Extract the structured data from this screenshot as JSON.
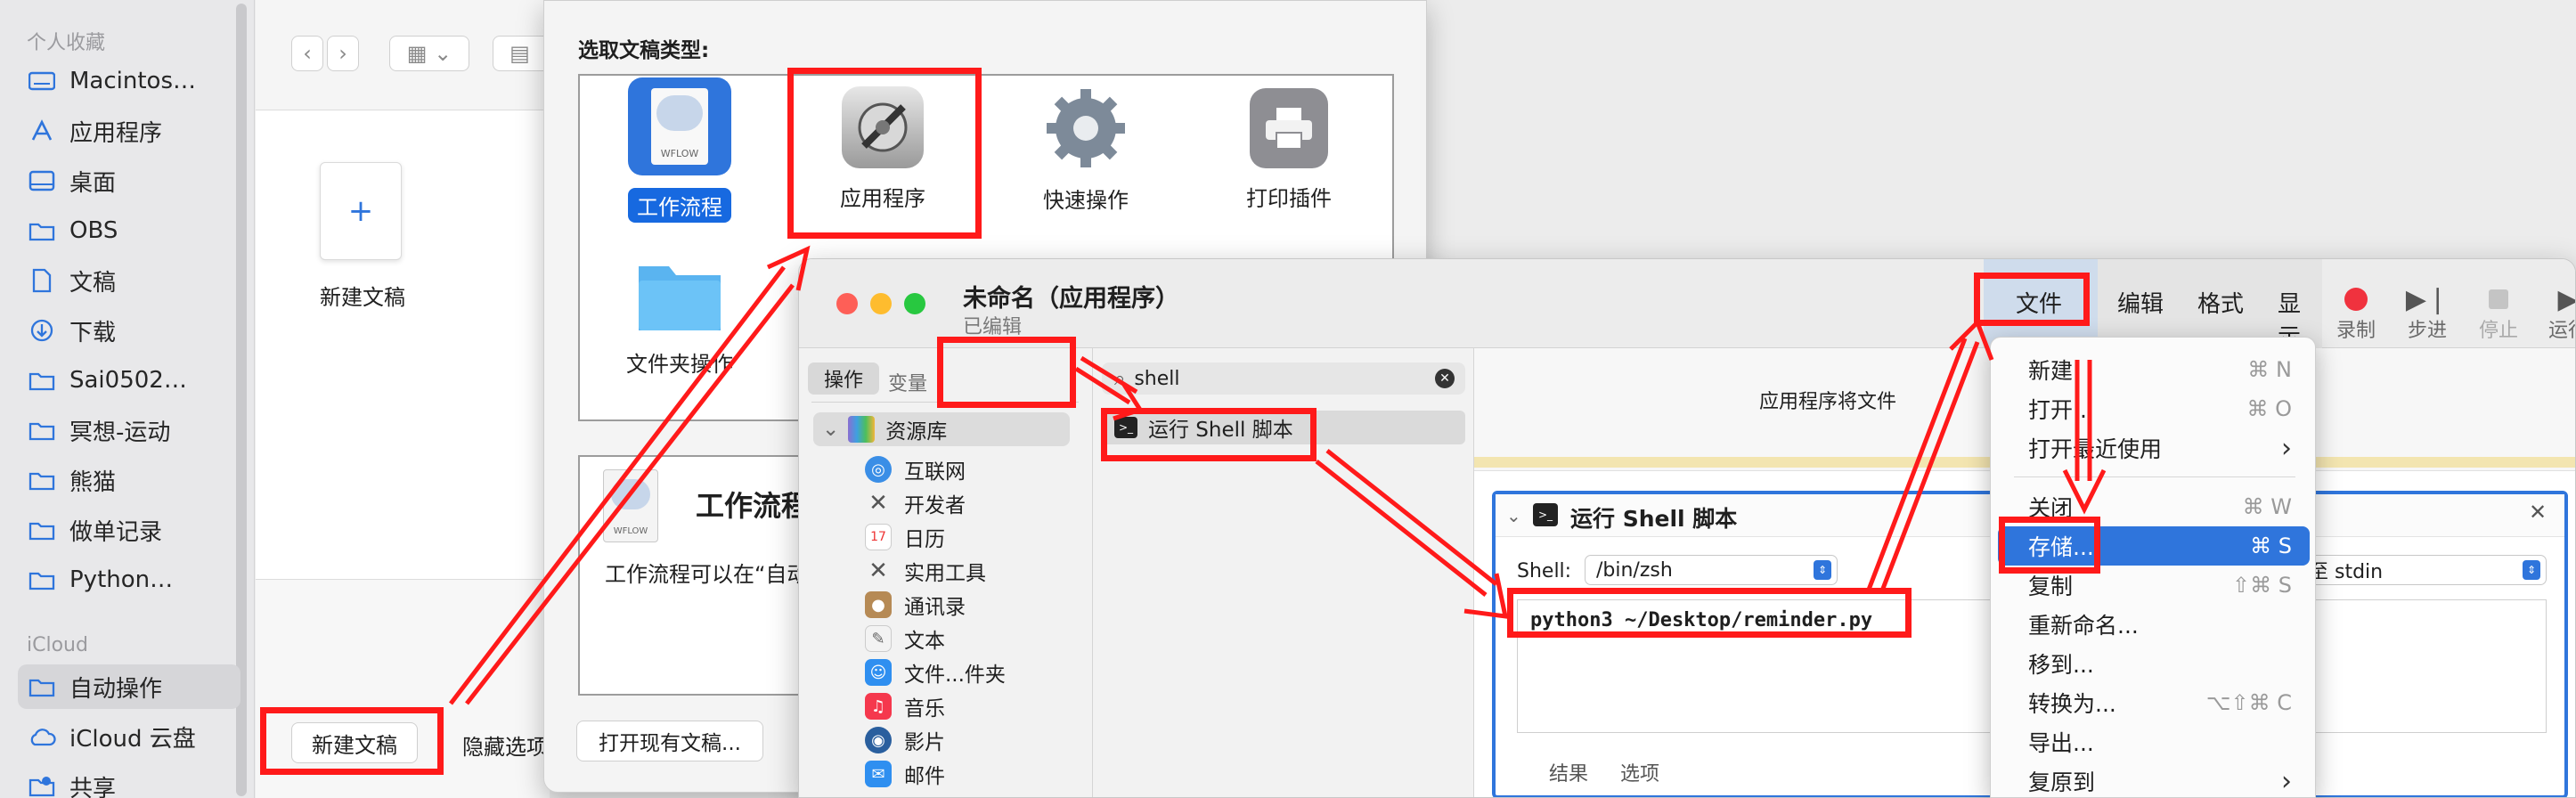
{
  "sidebar": {
    "favorites_header": "个人收藏",
    "favorites": [
      "Macintos…",
      "应用程序",
      "桌面",
      "OBS",
      "文稿",
      "下载",
      "Sai0502…",
      "冥想-运动",
      "熊猫",
      "做单记录",
      "Python…"
    ],
    "icloud_header": "iCloud",
    "icloud": [
      "自动操作",
      "iCloud 云盘",
      "共享"
    ]
  },
  "finder": {
    "new_doc_tile_label": "新建文稿",
    "new_doc_button": "新建文稿",
    "hide_options_button": "隐藏选项"
  },
  "chooser": {
    "heading": "选取文稿类型:",
    "types": [
      "工作流程",
      "应用程序",
      "快速操作",
      "打印插件",
      "文件夹操作"
    ],
    "selected_type": "工作流程",
    "wflow_badge": "WFLOW",
    "desc_title": "工作流程",
    "desc_text": "工作流程可以在“自动",
    "open_existing_button": "打开现有文稿..."
  },
  "automator": {
    "title": "未命名（应用程序）",
    "subtitle": "已编辑",
    "menu_bar": [
      "文件",
      "编辑",
      "格式",
      "显示"
    ],
    "toolbar": [
      "录制",
      "步进",
      "停止",
      "运行"
    ],
    "tabs": [
      "操作",
      "变量"
    ],
    "search_value": "shell",
    "library_root": "资源库",
    "library_items": [
      "互联网",
      "开发者",
      "日历",
      "实用工具",
      "通讯录",
      "文本",
      "文件...件夹",
      "音乐",
      "影片",
      "邮件"
    ],
    "action_result": "运行 Shell 脚本",
    "workflow_hint": "应用程序将文件",
    "action_title": "运行 Shell 脚本",
    "shell_label": "Shell:",
    "shell_value": "/bin/zsh",
    "pass_input_value": "至 stdin",
    "script": "python3 ~/Desktop/reminder.py",
    "bottom_tabs": [
      "结果",
      "选项"
    ]
  },
  "file_menu": {
    "items": [
      {
        "label": "新建",
        "shortcut": "⌘ N"
      },
      {
        "label": "打开...",
        "shortcut": "⌘ O"
      },
      {
        "label": "打开最近使用",
        "shortcut": "›"
      },
      {
        "label": "关闭",
        "shortcut": "⌘ W"
      },
      {
        "label": "存储...",
        "shortcut": "⌘ S"
      },
      {
        "label": "复制",
        "shortcut": "⇧⌘ S"
      },
      {
        "label": "重新命名...",
        "shortcut": ""
      },
      {
        "label": "移到...",
        "shortcut": ""
      },
      {
        "label": "转换为...",
        "shortcut": "⌥⇧⌘ C"
      },
      {
        "label": "导出...",
        "shortcut": ""
      },
      {
        "label": "复原到",
        "shortcut": "›"
      }
    ],
    "highlighted": "存储..."
  },
  "colors": {
    "annotation_red": "#ff1a1a",
    "accent_blue": "#2f75dc",
    "selection_blue": "#1769e0"
  }
}
